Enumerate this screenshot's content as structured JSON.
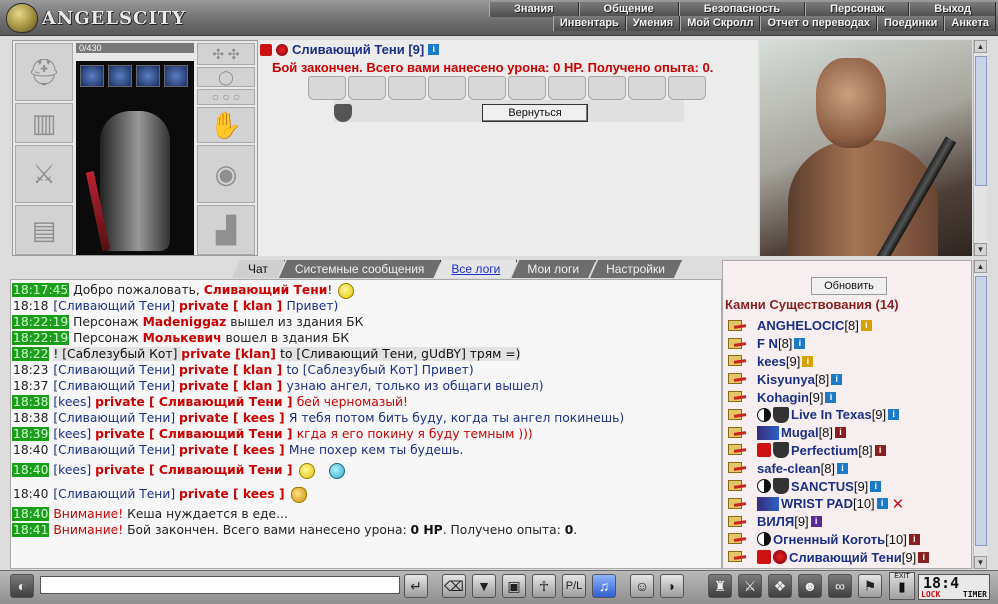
{
  "app": {
    "logo_text": "ANGELSCITY"
  },
  "menu_top": [
    "Знания",
    "Общение",
    "Безопасность",
    "Персонаж",
    "Выход"
  ],
  "menu_sub": [
    "Инвентарь",
    "Умения",
    "Мой Скролл",
    "Отчет о переводах",
    "Поединки",
    "Анкета"
  ],
  "character": {
    "hp_text": "0/430"
  },
  "battle": {
    "player_name": "Сливающий Тени [9]",
    "status": "Бой закончен. Всего вами нанесено урона: 0 HP. Получено опыта: 0.",
    "back_label": "Вернуться",
    "slot_count": 10
  },
  "chat": {
    "tabs": [
      "Чат",
      "Системные сообщения",
      "Все логи",
      "Мои логи",
      "Настройки"
    ],
    "input_value": ""
  },
  "chat_lines": [
    {
      "ts": "18:17:45",
      "ts_hl": true,
      "parts": [
        [
          "sys",
          "Добро пожаловать, "
        ],
        [
          "name-red",
          "Сливающий Тени"
        ],
        [
          "sys",
          "! "
        ]
      ],
      "emote": "smiley"
    },
    {
      "ts": "18:18",
      "ts_hl": false,
      "parts": [
        [
          "who",
          "[Сливающий Тени] "
        ],
        [
          "private",
          "private [ klan ] "
        ],
        [
          "txt-blue",
          "Привет)"
        ]
      ]
    },
    {
      "ts": "18:22:19",
      "ts_hl": true,
      "parts": [
        [
          "sys",
          "Персонаж "
        ],
        [
          "name-red",
          "Madeniggaz"
        ],
        [
          "sys",
          " вышел из здания БК"
        ]
      ]
    },
    {
      "ts": "18:22:19",
      "ts_hl": true,
      "parts": [
        [
          "sys",
          "Персонаж "
        ],
        [
          "name-red",
          "Молькевич"
        ],
        [
          "sys",
          " вошел в здания БК"
        ]
      ]
    },
    {
      "ts": "18:22",
      "ts_hl": true,
      "parts": [
        [
          "quote",
          "! [Саблезубый Кот] "
        ],
        [
          "private",
          "private [klan] "
        ],
        [
          "quote",
          "to [Сливающий Тени, gUdBY] трям =)"
        ]
      ]
    },
    {
      "ts": "18:23",
      "ts_hl": false,
      "parts": [
        [
          "who",
          "[Сливающий Тени] "
        ],
        [
          "private",
          "private [ klan ] "
        ],
        [
          "txt-blue",
          "to [Саблезубый Кот] Привет)"
        ]
      ]
    },
    {
      "ts": "18:37",
      "ts_hl": false,
      "parts": [
        [
          "who",
          "[Сливающий Тени] "
        ],
        [
          "private",
          "private [ klan ] "
        ],
        [
          "txt-blue",
          "узнаю ангел, только из общаги вышел)"
        ]
      ]
    },
    {
      "ts": "18:38",
      "ts_hl": true,
      "parts": [
        [
          "who",
          "[kees] "
        ],
        [
          "private",
          "private [ Сливающий Тени ] "
        ],
        [
          "txt-red",
          "бей черномазый!"
        ]
      ]
    },
    {
      "ts": "18:38",
      "ts_hl": false,
      "parts": [
        [
          "who",
          "[Сливающий Тени] "
        ],
        [
          "private",
          "private [ kees ] "
        ],
        [
          "txt-blue",
          "Я тебя потом бить буду, когда ты ангел покинешь)"
        ]
      ]
    },
    {
      "ts": "18:39",
      "ts_hl": true,
      "parts": [
        [
          "who",
          "[kees] "
        ],
        [
          "private",
          "private [ Сливающий Тени ] "
        ],
        [
          "txt-red",
          "кгда я его покину я буду темным )))"
        ]
      ]
    },
    {
      "ts": "18:40",
      "ts_hl": false,
      "parts": [
        [
          "who",
          "[Сливающий Тени] "
        ],
        [
          "private",
          "private [ kees ] "
        ],
        [
          "txt-blue",
          "Мне похер кем ты будешь."
        ]
      ]
    },
    {
      "ts": "18:40",
      "ts_hl": true,
      "parts": [
        [
          "who",
          "[kees] "
        ],
        [
          "private",
          "private [ Сливающий Тени ] "
        ]
      ],
      "emote": "smiley2",
      "gap": true
    },
    {
      "ts": "18:40",
      "ts_hl": false,
      "parts": [
        [
          "who",
          "[Сливающий Тени] "
        ],
        [
          "private",
          "private [ kees ] "
        ]
      ],
      "emote": "hat",
      "gap": true
    },
    {
      "ts": "18:40",
      "ts_hl": true,
      "parts": [
        [
          "warn",
          "Внимание! "
        ],
        [
          "sys",
          "Кеша нуждается в еде..."
        ]
      ]
    },
    {
      "ts": "18:41",
      "ts_hl": true,
      "parts": [
        [
          "warn",
          "Внимание! "
        ],
        [
          "sys",
          "Бой закончен. Всего вами нанесено урона: "
        ],
        [
          "bold",
          "0 HP"
        ],
        [
          "sys",
          ". Получено опыта: "
        ],
        [
          "bold",
          "0"
        ],
        [
          "sys",
          "."
        ]
      ]
    }
  ],
  "online": {
    "refresh_label": "Обновить",
    "title": "Камни Существования (14)",
    "users": [
      {
        "name": "ANGHELOCIC",
        "level": "[8]",
        "info": "yellow",
        "badges": []
      },
      {
        "name": "F N",
        "level": "[8]",
        "info": "blue",
        "badges": []
      },
      {
        "name": "kees",
        "level": "[9]",
        "info": "yellow",
        "badges": []
      },
      {
        "name": "Kisyunya",
        "level": "[8]",
        "info": "blue",
        "badges": []
      },
      {
        "name": "Kohagin",
        "level": "[9]",
        "info": "blue",
        "badges": []
      },
      {
        "name": "Live In Texas",
        "level": "[9]",
        "info": "blue",
        "badges": [
          "yin",
          "clan"
        ]
      },
      {
        "name": "Mugal",
        "level": "[8]",
        "info": "red",
        "badges": [
          "clanimg"
        ]
      },
      {
        "name": "Perfectium",
        "level": "[8]",
        "info": "red",
        "badges": [
          "cross",
          "clan"
        ]
      },
      {
        "name": "safe-clean",
        "level": "[8]",
        "info": "blue",
        "badges": []
      },
      {
        "name": "SANCTUS",
        "level": "[9]",
        "info": "blue",
        "badges": [
          "yin",
          "clan"
        ]
      },
      {
        "name": "WRIST PAD",
        "level": "[10]",
        "info": "blue",
        "badges": [
          "clanimg"
        ],
        "x": true
      },
      {
        "name": "ВИЛЯ",
        "level": "[9]",
        "info": "purple",
        "badges": []
      },
      {
        "name": "Огненный Коготь",
        "level": "[10]",
        "info": "red",
        "badges": [
          "yin"
        ]
      },
      {
        "name": "Сливающий Тени",
        "level": "[9]",
        "info": "red",
        "badges": [
          "cross",
          "rose"
        ]
      }
    ]
  },
  "clock": {
    "time": "18:4",
    "lock": "LOCK",
    "timer": "TIMER",
    "exit": "EXIT"
  },
  "icons": {
    "toolbar": [
      "speaker-icon",
      "send-icon",
      "clear-icon",
      "filter-icon",
      "save-icon",
      "dance-icon",
      "pl-icon",
      "music-icon",
      "smiley-icon",
      "helmet-icon",
      "bag-icon",
      "knife-icon",
      "gift-icon",
      "shield-icon",
      "mask-icon",
      "chains-icon",
      "lock-icon",
      "flag-icon"
    ]
  }
}
